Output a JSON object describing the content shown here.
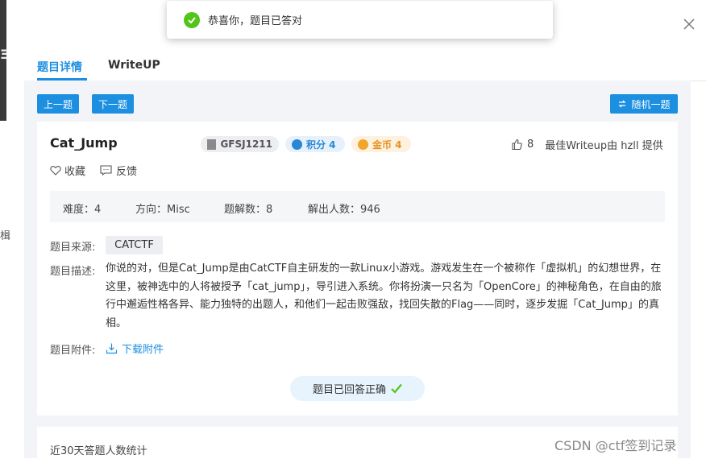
{
  "toast": {
    "message": "恭喜你，题目已答对"
  },
  "tabs": [
    {
      "label": "题目详情"
    },
    {
      "label": "WriteUP"
    }
  ],
  "nav": {
    "prev": "上一题",
    "next": "下一题",
    "random": "随机一题"
  },
  "challenge": {
    "title": "Cat_Jump",
    "id": "GFSJ1211",
    "score": "积分 4",
    "coins": "金币 4",
    "likes": "8",
    "writeup_credit": "最佳Writeup由 hzll 提供",
    "favorite": "收藏",
    "feedback": "反馈"
  },
  "stats": {
    "difficulty": "难度：4",
    "direction": "方向：Misc",
    "solution_count": "题解数：8",
    "solver_count": "解出人数：946"
  },
  "details": {
    "source_label": "题目来源:",
    "source": "CATCTF",
    "desc_label": "题目描述:",
    "description": "你说的对，但是Cat_Jump是由CatCTF自主研发的一款Linux小游戏。游戏发生在一个被称作「虚拟机」的幻想世界，在这里，被神选中的人将被授予「cat_jump」，导引进入系统。你将扮演一只名为「OpenCore」的神秘角色，在自由的旅行中邂逅性格各异、能力独特的出题人，和他们一起击败强敌，找回失散的Flag——同时，逐步发掘「Cat_Jump」的真相。",
    "attach_label": "题目附件:",
    "download": "下载附件"
  },
  "solved_status": "题目已回答正确",
  "section_30d": "近30天答题人数统计",
  "watermark": "CSDN @ctf签到记录",
  "edge": {
    "left_glyph": "Ξ",
    "left_char": "楫"
  },
  "colors": {
    "accent": "#1d8fe1",
    "success": "#52c41a",
    "panel": "#f2f4f7"
  },
  "icons": [
    "check-circle-icon",
    "close-icon",
    "refresh-icon",
    "thumbs-up-icon",
    "heart-icon",
    "feedback-icon",
    "download-icon",
    "checkmark-icon",
    "coin-icon",
    "score-icon",
    "id-icon"
  ]
}
